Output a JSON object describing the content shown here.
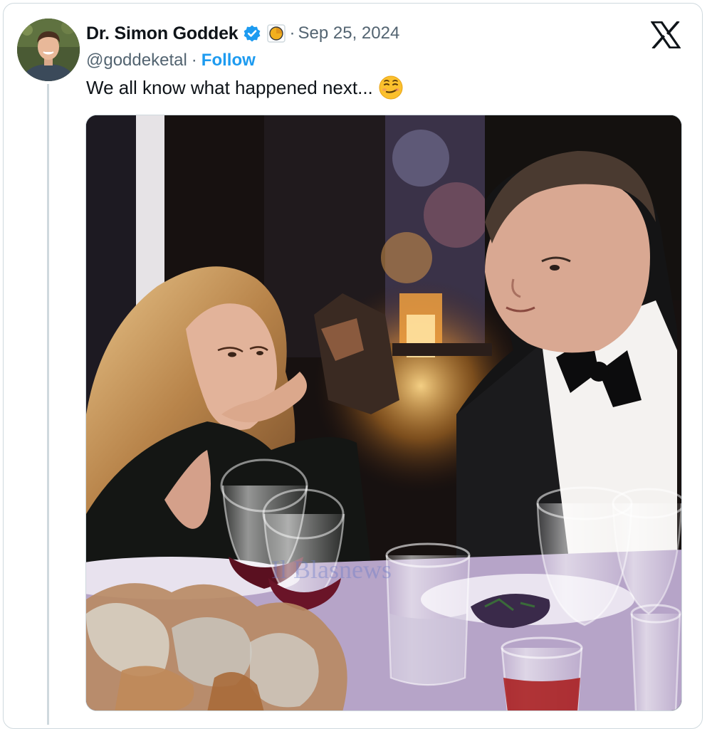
{
  "tweet": {
    "author": {
      "display_name": "Dr. Simon Goddek",
      "handle": "@goddeketal",
      "verified_icon": "verified-badge-icon",
      "affiliate_icon": "affiliate-badge-icon"
    },
    "separator": "·",
    "date": "Sep 25, 2024",
    "follow_label": "Follow",
    "text": "We all know what happened next...",
    "text_emoji": "smirking-face-emoji",
    "platform_icon": "x-logo-icon",
    "media": {
      "watermark": "Il Blasnews"
    }
  },
  "colors": {
    "link_blue": "#1d9bf0",
    "secondary_text": "#536471",
    "primary_text": "#0f1419",
    "border": "#cfd9de"
  }
}
